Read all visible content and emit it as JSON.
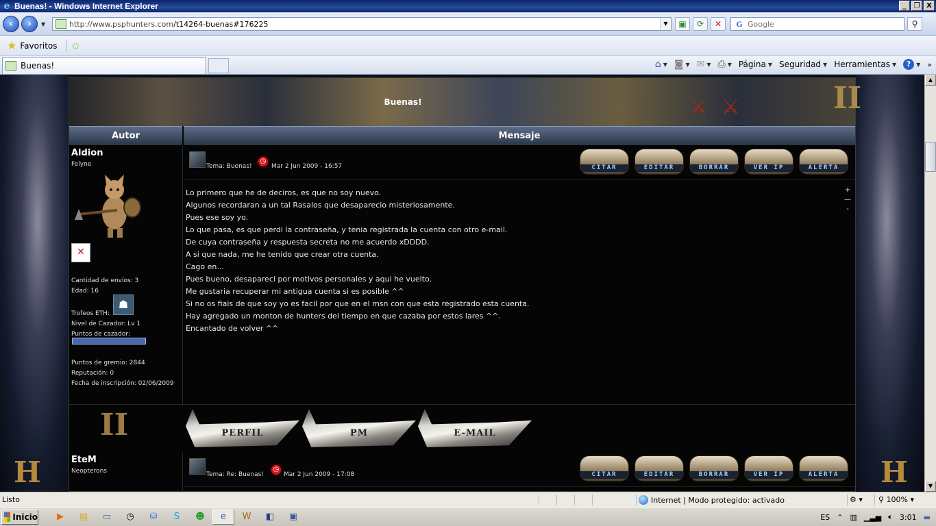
{
  "window": {
    "title": "Buenas! - Windows Internet Explorer",
    "buttons": [
      "_",
      "❐",
      "X"
    ]
  },
  "address": {
    "url_prefix": "http://www.psphunters.com",
    "url_path": "/t14264-buenas#176225",
    "search_placeholder": "Google"
  },
  "favorites": {
    "label": "Favoritos"
  },
  "tab": {
    "title": "Buenas!"
  },
  "commands": {
    "page": "Página",
    "security": "Seguridad",
    "tools": "Herramientas"
  },
  "forum": {
    "topic_title": "Buenas!",
    "col_author": "Autor",
    "col_message": "Mensaje",
    "action_buttons": [
      "CITAR",
      "EDITAR",
      "BORRAR",
      "VER IP",
      "ALERTA"
    ],
    "profile_buttons": [
      "PERFIL",
      "PM",
      "E-MAIL"
    ],
    "posts": [
      {
        "author": "Aldion",
        "rank": "Felyne",
        "stats": {
          "envios": "Cantidad de envíos: 3",
          "edad": "Edad: 16",
          "trofeos": "Trofeos ETH:",
          "nivel": "Nivel de Cazador: Lv 1",
          "puntos_cazador": "Puntos de cazador:",
          "puntos_cazador_fill": 1.0,
          "gremio": "Puntos de gremio: 2844",
          "reputacion": "Reputación: 0",
          "inscripcion": "Fecha de inscripción: 02/06/2009"
        },
        "topic": "Tema: Buenas!",
        "date": "Mar 2 Jun 2009 - 16:57",
        "body": [
          "Lo primero que he de deciros, es que no soy nuevo.",
          "Algunos recordaran a un tal Rasalos que desaparecio misteriosamente.",
          "Pues ese soy yo.",
          "Lo que pasa, es que perdi la contraseña, y tenia registrada la cuenta con otro e-mail.",
          "De cuya contraseña y respuesta secreta no me acuerdo xDDDD.",
          "A si que nada, me he tenido que crear otra cuenta.",
          "Cago en...",
          "Pues bueno, desapareci por motivos personales y aqui he vuelto.",
          "Me gustaria recuperar mi antigua cuenta si es posible ^^",
          "Si no os fiais de que soy yo es facil por que en el msn con que esta registrado esta cuenta.",
          "Hay agregado un monton de hunters del tiempo en que cazaba por estos lares ^^.",
          "Encantado de volver ^^"
        ],
        "zoom": [
          "+",
          "—",
          "-"
        ]
      },
      {
        "author": "EteM",
        "rank": "Neopterons",
        "topic": "Tema: Re: Buenas!",
        "date": "Mar 2 Jun 2009 - 17:08"
      }
    ]
  },
  "status": {
    "text": "Listo",
    "zone": "Internet | Modo protegido: activado",
    "zoom": "100%"
  },
  "taskbar": {
    "start": "Inicio",
    "lang": "ES",
    "time": "3:01"
  }
}
